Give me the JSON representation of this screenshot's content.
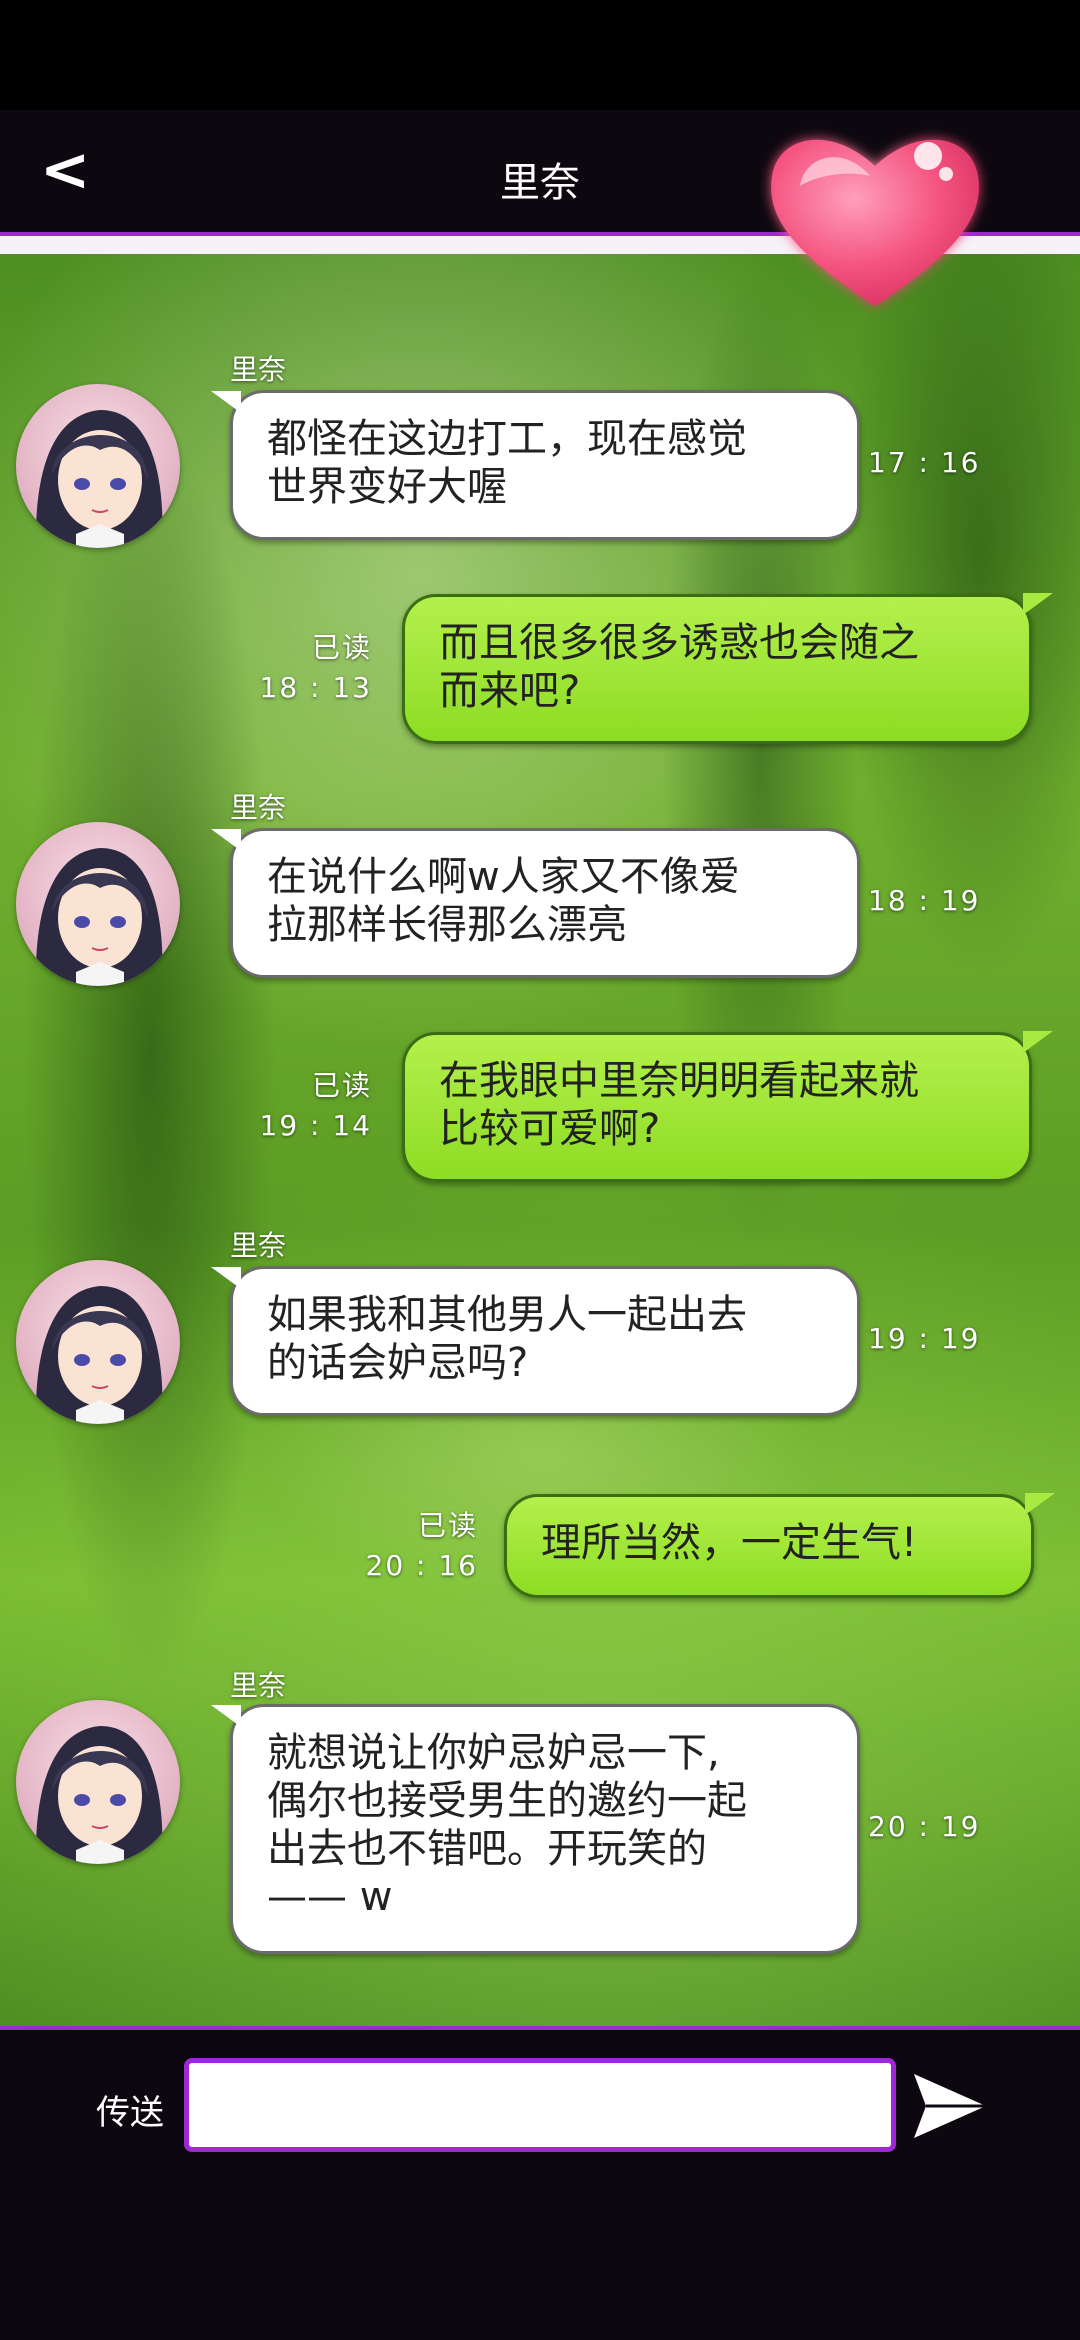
{
  "header": {
    "back_label": "<",
    "title": "里奈"
  },
  "messages": [
    {
      "direction": "in",
      "sender": "里奈",
      "lines": [
        "都怪在这边打工，现在感觉",
        "世界变好大喔"
      ],
      "time": "17 : 16"
    },
    {
      "direction": "out",
      "read": "已读",
      "lines": [
        "而且很多很多诱惑也会随之",
        "而来吧?"
      ],
      "time": "18 : 13"
    },
    {
      "direction": "in",
      "sender": "里奈",
      "lines": [
        "在说什么啊w人家又不像爱",
        "拉那样长得那么漂亮"
      ],
      "time": "18 : 19"
    },
    {
      "direction": "out",
      "read": "已读",
      "lines": [
        "在我眼中里奈明明看起来就",
        "比较可爱啊?"
      ],
      "time": "19 : 14"
    },
    {
      "direction": "in",
      "sender": "里奈",
      "lines": [
        "如果我和其他男人一起出去",
        "的话会妒忌吗?"
      ],
      "time": "19 : 19"
    },
    {
      "direction": "out",
      "read": "已读",
      "lines": [
        "理所当然，一定生气!"
      ],
      "time": "20 : 16"
    },
    {
      "direction": "in",
      "sender": "里奈",
      "lines": [
        "就想说让你妒忌妒忌一下,",
        "偶尔也接受男生的邀约一起",
        "出去也不错吧。开玩笑的",
        "—— w"
      ],
      "time": "20 : 19"
    }
  ],
  "input_bar": {
    "send_label": "传送",
    "input_value": "",
    "input_placeholder": ""
  },
  "colors": {
    "accent": "#a027d8",
    "incoming_bubble": "#ffffff",
    "outgoing_bubble": "#9be337",
    "heart": "#f4547f"
  },
  "icons": {
    "back": "back-arrow-icon",
    "heart": "heart-icon",
    "send": "send-arrow-icon"
  }
}
